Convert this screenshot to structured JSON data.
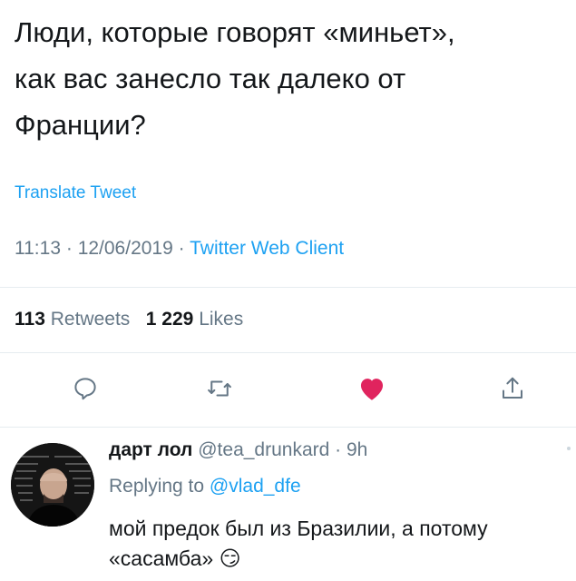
{
  "tweet": {
    "text": "Люди, которые говорят «миньет»,\nкак вас занесло так далеко от\nФранции?",
    "translate_label": "Translate Tweet",
    "time": "11:13",
    "date": "12/06/2019",
    "separator": "·",
    "client": "Twitter Web Client",
    "retweets_count": "113",
    "retweets_label": "Retweets",
    "likes_count": "1 229",
    "likes_label": "Likes"
  },
  "actions": [
    {
      "icon": "reply-icon"
    },
    {
      "icon": "retweet-icon"
    },
    {
      "icon": "heart-icon",
      "color": "#e0245e"
    },
    {
      "icon": "share-icon"
    }
  ],
  "reply": {
    "name": "дарт лол",
    "handle": "@tea_drunkard",
    "time": "9h",
    "replying_prefix": "Replying to",
    "replying_handle": "@vlad_dfe",
    "text": "мой предок был из Бразилии, а потому «сасамба»",
    "emoji": "😏"
  },
  "colors": {
    "accent": "#1da1f2",
    "secondary": "#657786",
    "like": "#e0245e"
  }
}
